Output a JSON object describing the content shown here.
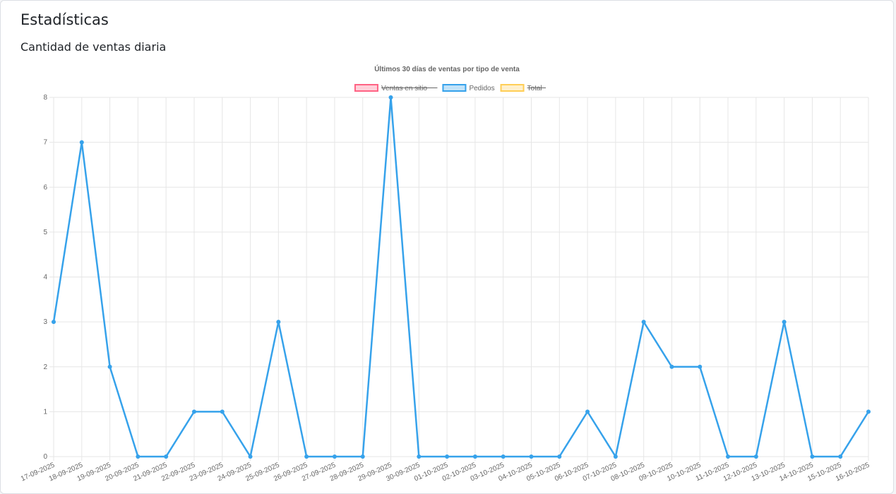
{
  "page": {
    "title": "Estadísticas",
    "section_title": "Cantidad de ventas diaria"
  },
  "chart_data": {
    "type": "line",
    "title": "Últimos 30 días de ventas por tipo de venta",
    "xlabel": "",
    "ylabel": "",
    "ylim": [
      0,
      8
    ],
    "yticks": [
      0,
      1,
      2,
      3,
      4,
      5,
      6,
      7,
      8
    ],
    "grid": true,
    "legend_position": "top",
    "x": [
      "17-09-2025",
      "18-09-2025",
      "19-09-2025",
      "20-09-2025",
      "21-09-2025",
      "22-09-2025",
      "23-09-2025",
      "24-09-2025",
      "25-09-2025",
      "26-09-2025",
      "27-09-2025",
      "28-09-2025",
      "29-09-2025",
      "30-09-2025",
      "01-10-2025",
      "02-10-2025",
      "03-10-2025",
      "04-10-2025",
      "05-10-2025",
      "06-10-2025",
      "07-10-2025",
      "08-10-2025",
      "09-10-2025",
      "10-10-2025",
      "11-10-2025",
      "12-10-2025",
      "13-10-2025",
      "14-10-2025",
      "15-10-2025",
      "16-10-2025"
    ],
    "series": [
      {
        "name": "Ventas en sitio",
        "color": "#ff6384",
        "hidden": true,
        "values": []
      },
      {
        "name": "Pedidos",
        "color": "#36a2eb",
        "hidden": false,
        "values": [
          3,
          7,
          2,
          0,
          0,
          1,
          1,
          0,
          3,
          0,
          0,
          0,
          8,
          0,
          0,
          0,
          0,
          0,
          0,
          1,
          0,
          3,
          2,
          2,
          0,
          0,
          3,
          0,
          0,
          1
        ]
      },
      {
        "name": "Total",
        "color": "#ffce56",
        "hidden": true,
        "values": []
      }
    ]
  }
}
